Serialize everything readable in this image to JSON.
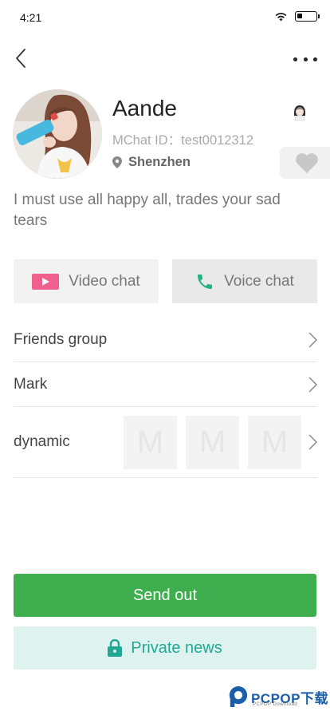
{
  "status_bar": {
    "time": "4:21",
    "battery_level": 0.3
  },
  "nav": {
    "back_icon": "chevron-left-icon",
    "more_icon": "ellipsis-icon"
  },
  "profile": {
    "name": "Aande",
    "mchat_id": "MChat ID：test0012312",
    "location": "Shenzhen",
    "gender_icon": "girl-icon",
    "like_icon": "heart-icon"
  },
  "signature": "I must use all happy all, trades your sad tears",
  "chat_buttons": {
    "video_label": "Video chat",
    "voice_label": "Voice chat"
  },
  "menu": {
    "friends_group": "Friends group",
    "mark": "Mark",
    "dynamic": "dynamic",
    "dynamic_placeholders": [
      "M",
      "M",
      "M"
    ]
  },
  "actions": {
    "send_label": "Send out",
    "private_label": "Private news"
  },
  "watermark": {
    "text": "PCPOP下载",
    "sub": "PCPOP Download"
  },
  "colors": {
    "send_green": "#3eae4e",
    "private_bg": "#def2f0",
    "private_teal": "#22a794",
    "video_pink": "#f0608d",
    "voice_green": "#22b47d"
  }
}
